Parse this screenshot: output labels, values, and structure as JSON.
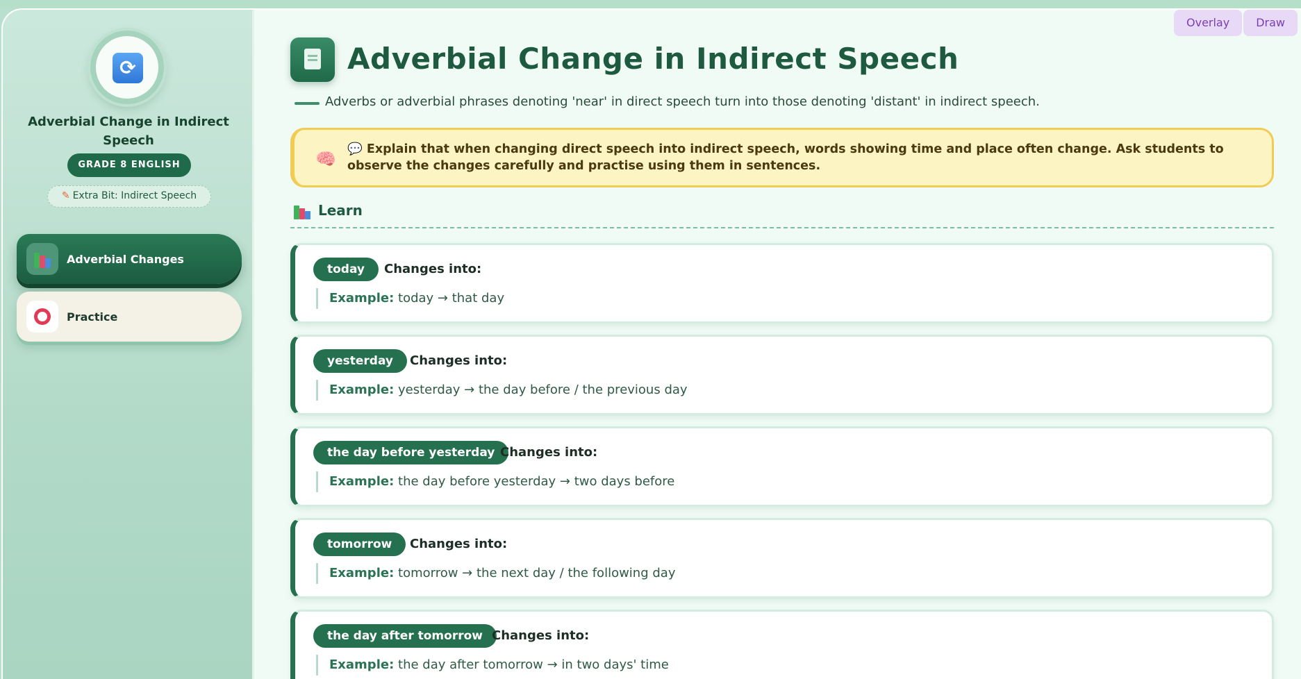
{
  "app": {
    "title": "Adverbial Change in Indirect Speech",
    "grade": "GRADE 8 ENGLISH",
    "extra": "Extra Bit: Indirect Speech"
  },
  "nav": [
    {
      "label": "Adverbial Changes",
      "icon": "books-icon",
      "active": true
    },
    {
      "label": "Practice",
      "icon": "ring-icon",
      "active": false
    }
  ],
  "toolbar": {
    "overlay": "Overlay",
    "draw": "Draw"
  },
  "main": {
    "title": "Adverbial Change in Indirect Speech",
    "subtitle": "Adverbs or adverbial phrases denoting 'near' in direct speech turn into those denoting 'distant' in indirect speech.",
    "note": "💬 Explain that when changing direct speech into indirect speech, words showing time and place often change. Ask students to observe the changes carefully and practise using them in sentences.",
    "learn_heading": "Learn"
  },
  "cards": [
    {
      "word": "today",
      "changes": "Changes into:",
      "example_label": "Example:",
      "example": "today → that day"
    },
    {
      "word": "yesterday",
      "changes": "Changes into:",
      "example_label": "Example:",
      "example": "yesterday → the day before / the previous day"
    },
    {
      "word": "the day before yesterday",
      "changes": "Changes into:",
      "example_label": "Example:",
      "example": "the day before yesterday → two days before"
    },
    {
      "word": "tomorrow",
      "changes": "Changes into:",
      "example_label": "Example:",
      "example": "tomorrow → the next day / the following day"
    },
    {
      "word": "the day after tomorrow",
      "changes": "Changes into:",
      "example_label": "Example:",
      "example": "the day after tomorrow → in two days' time"
    }
  ]
}
